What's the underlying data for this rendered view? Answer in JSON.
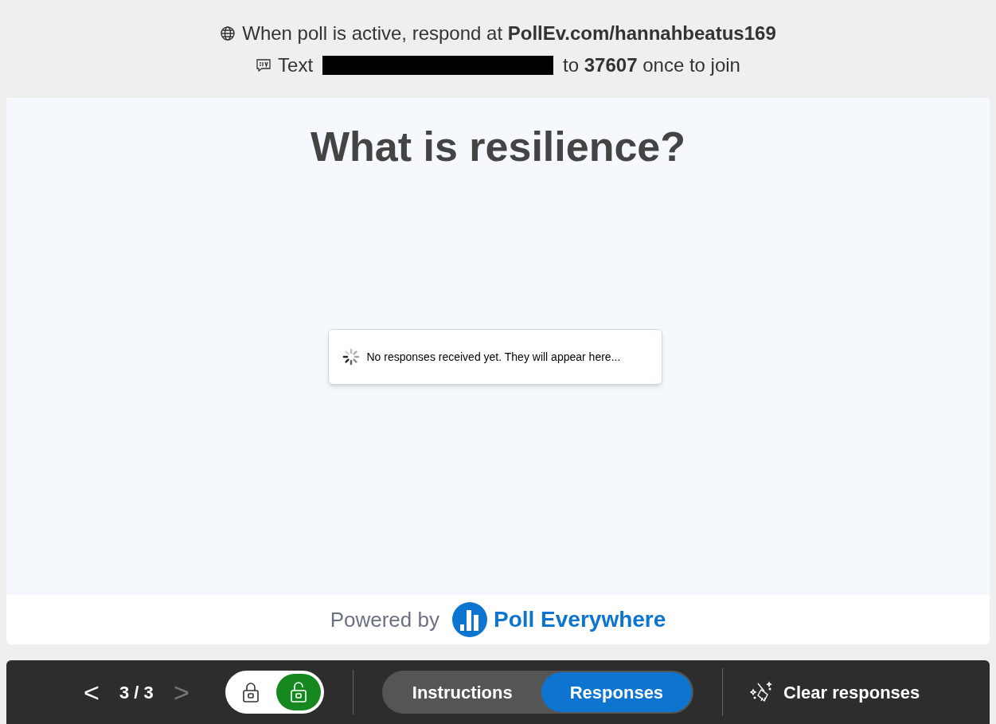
{
  "header": {
    "respond_line": "When poll is active, respond at **PollEv.com/hannahbeatus169**",
    "sms_label": "Text",
    "sms_rest": "to **37607** once to join"
  },
  "question": {
    "title": "What is resilience?",
    "status": "No responses received yet. They will appear here..."
  },
  "footer": {
    "powered_by": "Powered by",
    "brand": "Poll Everywhere"
  },
  "toolbar": {
    "prev": {
      "label": "<",
      "disabled": false
    },
    "counter": "3 / 3",
    "next": {
      "label": ">",
      "disabled": true
    },
    "lock": [
      {
        "kind": "locked",
        "selected": false
      },
      {
        "kind": "unlocked",
        "selected": true
      }
    ],
    "tabs": [
      {
        "label": "Instructions",
        "selected": false
      },
      {
        "label": "Responses",
        "selected": true
      }
    ],
    "clear": "Clear responses"
  }
}
